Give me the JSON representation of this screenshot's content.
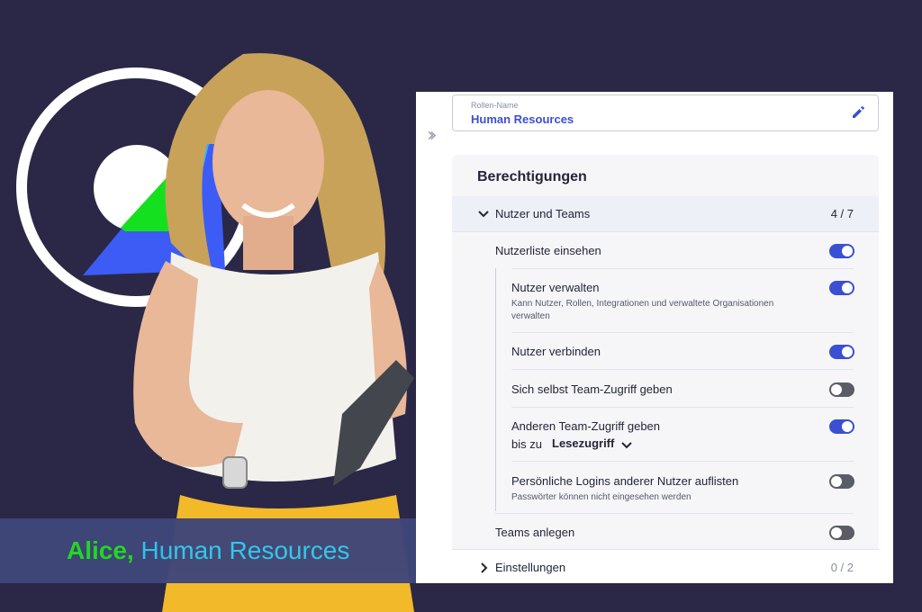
{
  "caption": {
    "name": "Alice,",
    "role": "Human Resources"
  },
  "role_field": {
    "label": "Rollen-Name",
    "value": "Human Resources"
  },
  "permissions": {
    "title": "Berechtigungen",
    "group": {
      "label": "Nutzer und Teams",
      "count": "4 / 7"
    },
    "rows": [
      {
        "label": "Nutzerliste einsehen",
        "enabled": true
      },
      {
        "label": "Nutzer verwalten",
        "description": "Kann Nutzer, Rollen, Integrationen und verwaltete Organisationen verwalten",
        "enabled": true
      },
      {
        "label": "Nutzer verbinden",
        "enabled": true
      },
      {
        "label": "Sich selbst Team-Zugriff geben",
        "enabled": false
      },
      {
        "label": "Anderen Team-Zugriff geben",
        "sub_prefix": "bis zu",
        "sub_select": "Lesezugriff",
        "enabled": true
      },
      {
        "label": "Persönliche Logins anderer Nutzer auflisten",
        "description": "Passwörter können nicht eingesehen werden",
        "enabled": false
      },
      {
        "label": "Teams anlegen",
        "enabled": false
      }
    ],
    "group2": {
      "label": "Einstellungen",
      "count": "0 / 2"
    }
  },
  "colors": {
    "accent": "#3a4fd1",
    "background": "#2a2846",
    "caption_name": "#22dd22",
    "caption_role": "#2ec8f0"
  },
  "icons": {
    "collapse": "double-chevron-right-icon",
    "edit": "pencil-icon"
  }
}
